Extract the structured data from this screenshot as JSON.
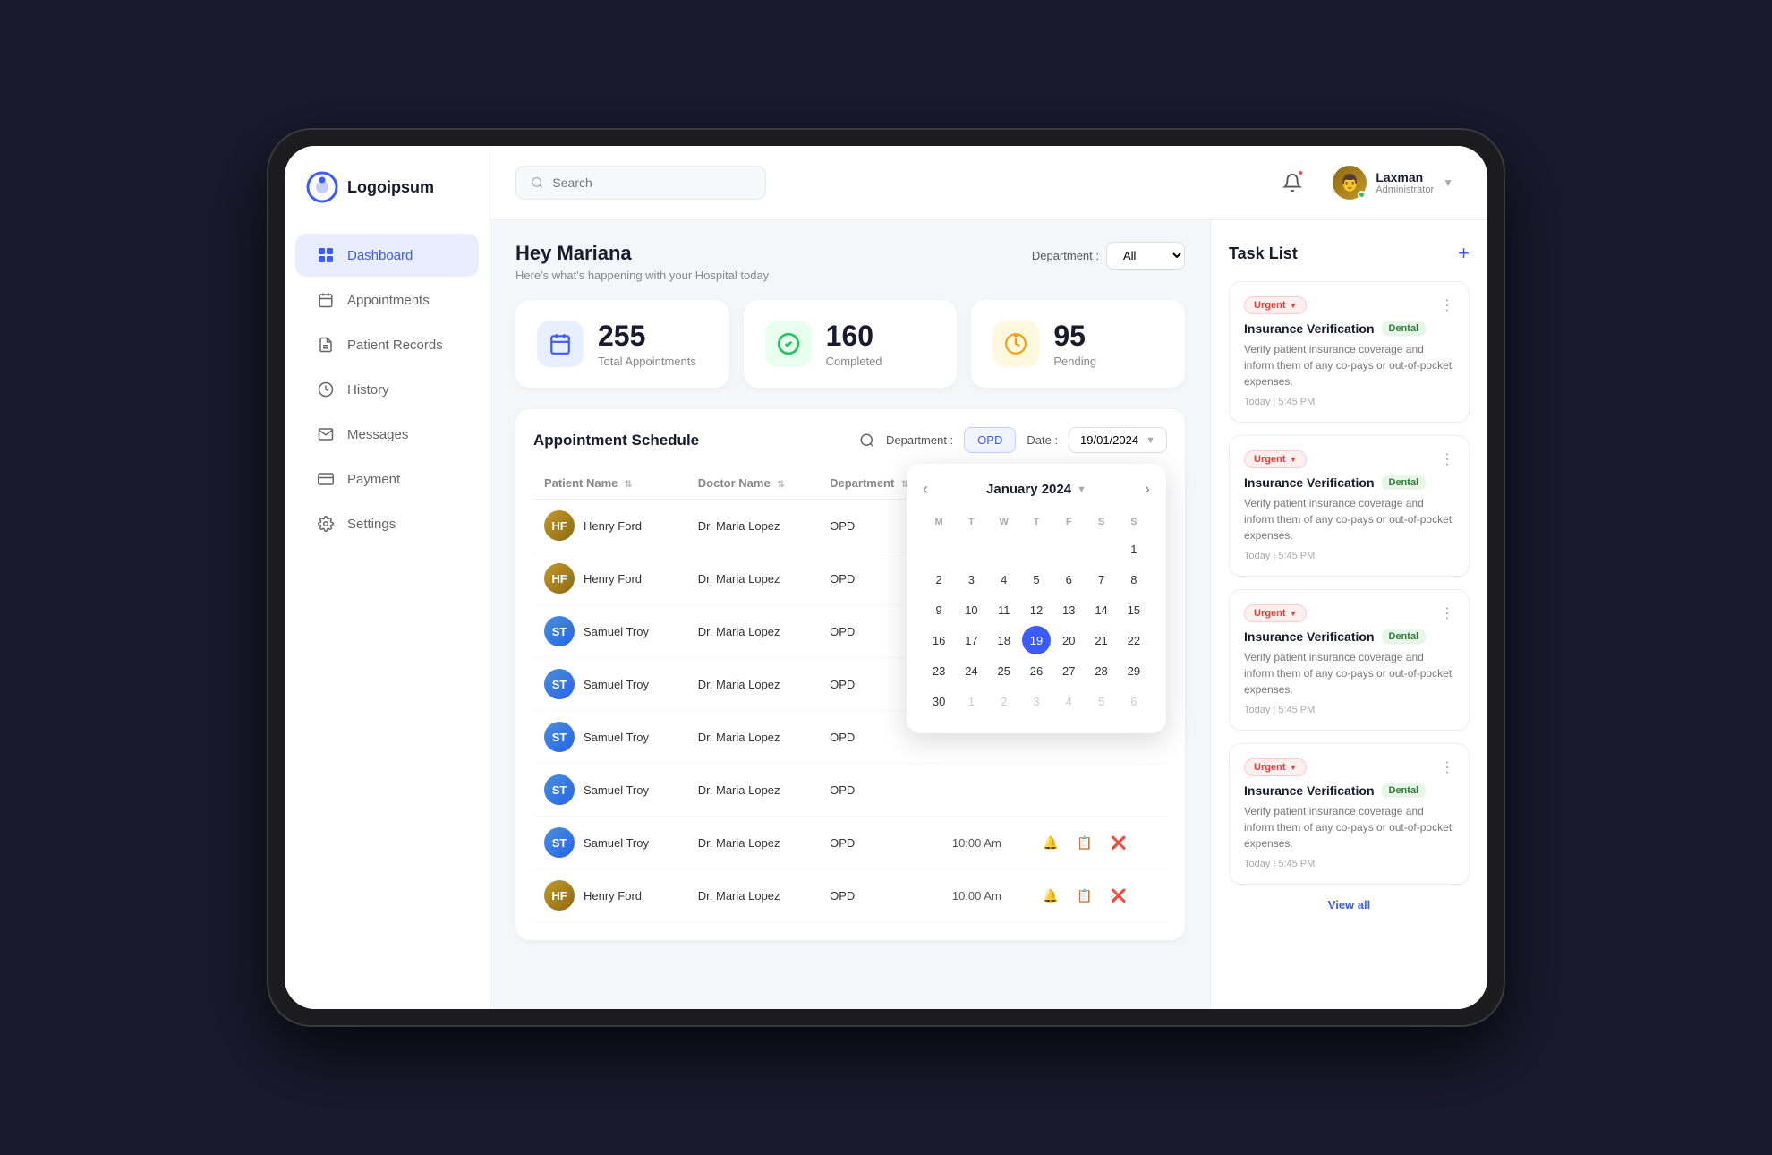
{
  "app": {
    "name": "Logoipsum"
  },
  "header": {
    "search_placeholder": "Search",
    "user": {
      "name": "Laxman",
      "role": "Administrator"
    },
    "avatar_emoji": "👤"
  },
  "sidebar": {
    "items": [
      {
        "id": "dashboard",
        "label": "Dashboard",
        "active": true,
        "icon": "⊞"
      },
      {
        "id": "appointments",
        "label": "Appointments",
        "active": false,
        "icon": "≡"
      },
      {
        "id": "patient-records",
        "label": "Patient Records",
        "active": false,
        "icon": "📋"
      },
      {
        "id": "history",
        "label": "History",
        "active": false,
        "icon": "🗂"
      },
      {
        "id": "messages",
        "label": "Messages",
        "active": false,
        "icon": "✉"
      },
      {
        "id": "payment",
        "label": "Payment",
        "active": false,
        "icon": "💳"
      },
      {
        "id": "settings",
        "label": "Settings",
        "active": false,
        "icon": "⚙"
      }
    ]
  },
  "greeting": {
    "heading": "Hey Mariana",
    "subtext": "Here's what's happening with your Hospital today",
    "dept_label": "Department :",
    "dept_value": "All"
  },
  "stats": [
    {
      "id": "total",
      "value": "255",
      "label": "Total Appointments",
      "icon": "📅",
      "color": "blue"
    },
    {
      "id": "completed",
      "value": "160",
      "label": "Completed",
      "icon": "✅",
      "color": "green"
    },
    {
      "id": "pending",
      "value": "95",
      "label": "Pending",
      "icon": "⏰",
      "color": "yellow"
    }
  ],
  "appointment_section": {
    "title": "Appointment Schedule",
    "dept_label": "Department :",
    "dept_value": "OPD",
    "date_label": "Date :",
    "date_value": "19/01/2024",
    "columns": [
      "Patient Name",
      "Doctor Name",
      "Department",
      "",
      ""
    ],
    "rows": [
      {
        "patient": "Henry Ford",
        "doctor": "Dr. Maria Lopez",
        "dept": "OPD",
        "time": "",
        "avatarColor": "brown"
      },
      {
        "patient": "Henry Ford",
        "doctor": "Dr. Maria Lopez",
        "dept": "OPD",
        "time": "",
        "avatarColor": "brown"
      },
      {
        "patient": "Samuel Troy",
        "doctor": "Dr. Maria Lopez",
        "dept": "OPD",
        "time": "",
        "avatarColor": "blue"
      },
      {
        "patient": "Samuel Troy",
        "doctor": "Dr. Maria Lopez",
        "dept": "OPD",
        "time": "",
        "avatarColor": "blue"
      },
      {
        "patient": "Samuel Troy",
        "doctor": "Dr. Maria Lopez",
        "dept": "OPD",
        "time": "",
        "avatarColor": "blue"
      },
      {
        "patient": "Samuel Troy",
        "doctor": "Dr. Maria Lopez",
        "dept": "OPD",
        "time": "",
        "avatarColor": "blue"
      },
      {
        "patient": "Samuel Troy",
        "doctor": "Dr. Maria Lopez",
        "dept": "OPD",
        "time": "10:00 Am",
        "avatarColor": "blue"
      },
      {
        "patient": "Henry Ford",
        "doctor": "Dr. Maria Lopez",
        "dept": "OPD",
        "time": "10:00 Am",
        "avatarColor": "brown"
      }
    ]
  },
  "calendar": {
    "month_year": "January 2024",
    "days_header": [
      "M",
      "T",
      "W",
      "T",
      "F",
      "S",
      "S"
    ],
    "weeks": [
      [
        null,
        null,
        null,
        null,
        null,
        null,
        1
      ],
      [
        2,
        3,
        4,
        5,
        6,
        7,
        8
      ],
      [
        9,
        10,
        11,
        12,
        13,
        14,
        15
      ],
      [
        16,
        17,
        18,
        19,
        20,
        21,
        22
      ],
      [
        23,
        24,
        25,
        26,
        27,
        28,
        29
      ],
      [
        30,
        1,
        2,
        3,
        4,
        5,
        6
      ]
    ],
    "today": 19,
    "other_month_last": [
      1,
      2,
      3,
      4,
      5,
      6
    ]
  },
  "tasks": {
    "title": "Task List",
    "add_label": "+",
    "view_all_label": "View all",
    "items": [
      {
        "priority": "Urgent",
        "name": "Insurance Verification",
        "category": "Dental",
        "description": "Verify patient insurance coverage and inform them of any co-pays or out-of-pocket expenses.",
        "time": "Today | 5:45 PM"
      },
      {
        "priority": "Urgent",
        "name": "Insurance Verification",
        "category": "Dental",
        "description": "Verify patient insurance coverage and inform them of any co-pays or out-of-pocket expenses.",
        "time": "Today | 5:45 PM"
      },
      {
        "priority": "Urgent",
        "name": "Insurance Verification",
        "category": "Dental",
        "description": "Verify patient insurance coverage and inform them of any co-pays or out-of-pocket expenses.",
        "time": "Today | 5:45 PM"
      },
      {
        "priority": "Urgent",
        "name": "Insurance Verification",
        "category": "Dental",
        "description": "Verify patient insurance coverage and inform them of any co-pays or out-of-pocket expenses.",
        "time": "Today | 5:45 PM"
      }
    ]
  }
}
